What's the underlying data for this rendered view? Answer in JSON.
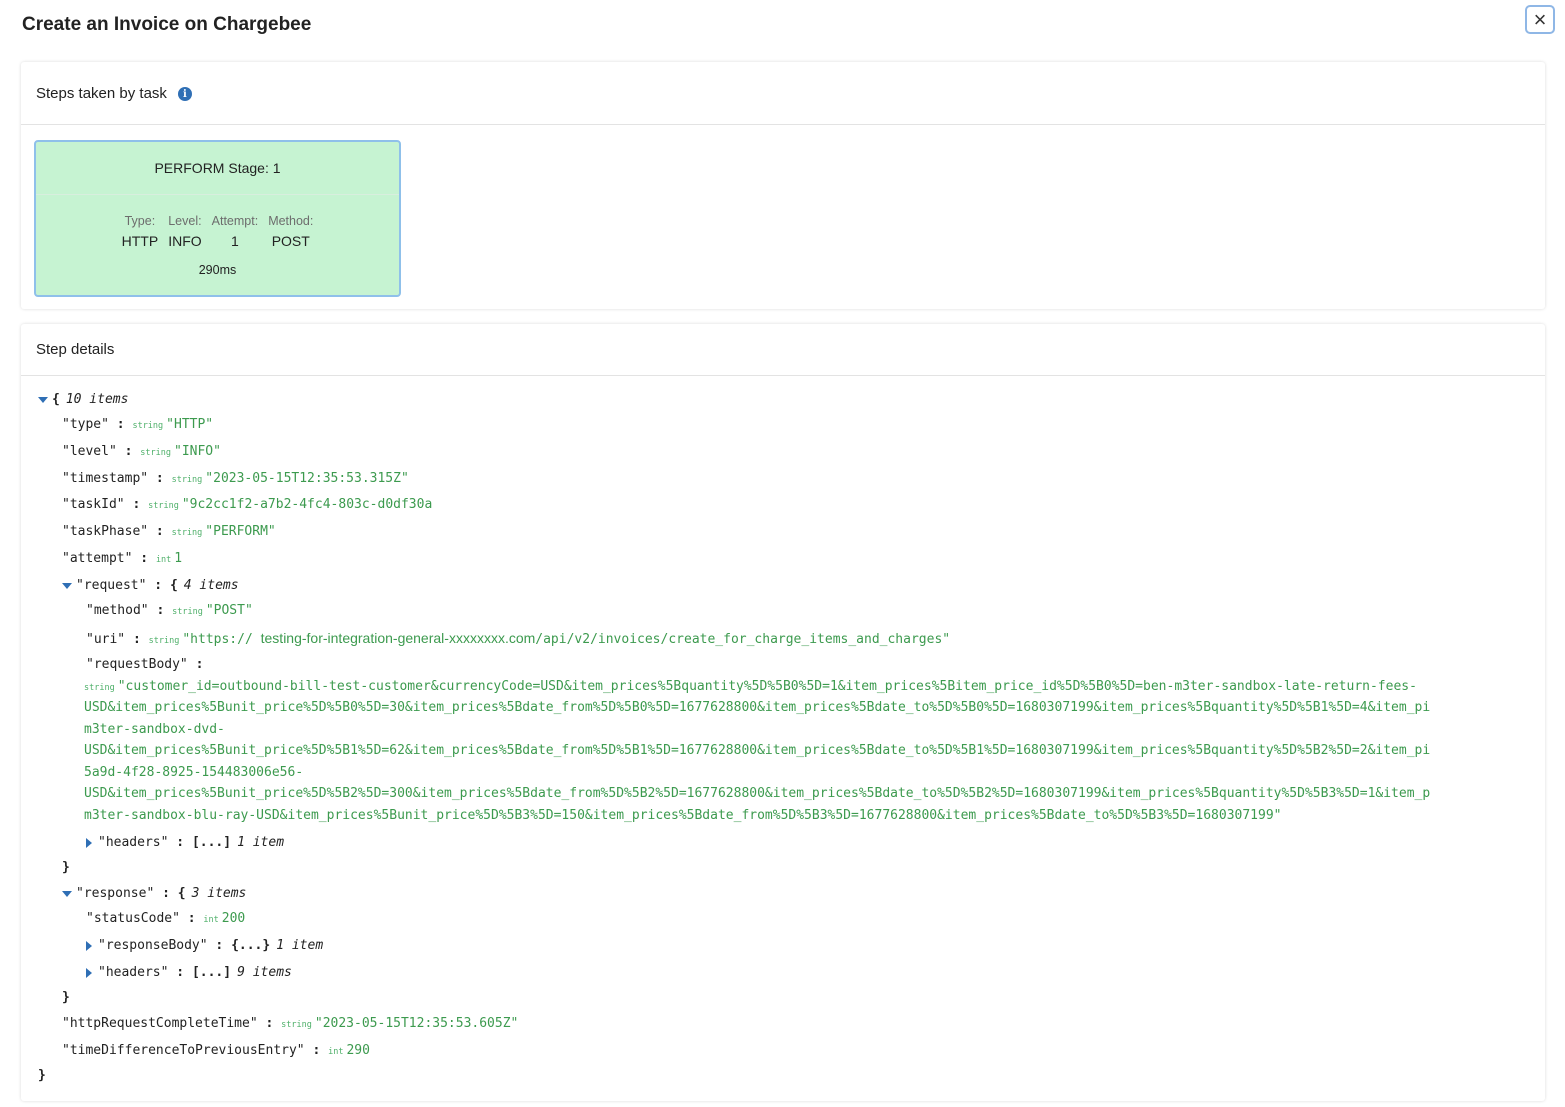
{
  "modal": {
    "title": "Create an Invoice on Chargebee",
    "close_label": "×"
  },
  "steps_panel": {
    "title": "Steps taken by task",
    "info_icon": "i",
    "stage": {
      "title": "PERFORM Stage: 1",
      "type_label": "Type:",
      "type_value": "HTTP",
      "level_label": "Level:",
      "level_value": "INFO",
      "attempt_label": "Attempt:",
      "attempt_value": "1",
      "method_label": "Method:",
      "method_value": "POST",
      "duration": "290ms"
    }
  },
  "details_panel": {
    "title": "Step details",
    "root_count": "10 items",
    "type_key": "\"type\"",
    "type_val": "\"HTTP\"",
    "level_key": "\"level\"",
    "level_val": "\"INFO\"",
    "timestamp_key": "\"timestamp\"",
    "timestamp_val": "\"2023-05-15T12:35:53.315Z\"",
    "taskId_key": "\"taskId\"",
    "taskId_val": "\"9c2cc1f2-a7b2-4fc4-803c-d0df30a",
    "taskPhase_key": "\"taskPhase\"",
    "taskPhase_val": "\"PERFORM\"",
    "attempt_key": "\"attempt\"",
    "attempt_val": "1",
    "request_key": "\"request\"",
    "request_count": "4 items",
    "method_key": "\"method\"",
    "method_val": "\"POST\"",
    "uri_key": "\"uri\"",
    "uri_prefix": "\"https://",
    "uri_host": "testing-for-integration-general-xxxxxxxx.com",
    "uri_path": "/api/v2/invoices/create_for_charge_items_and_charges\"",
    "requestBody_key": "\"requestBody\"",
    "requestBody_lines": [
      "\"customer_id=outbound-bill-test-customer&currencyCode=USD&item_prices%5Bquantity%5D%5B0%5D=1&item_prices%5Bitem_price_id%5D%5B0%5D=ben-m3ter-sandbox-late-return-fees-",
      "USD&item_prices%5Bunit_price%5D%5B0%5D=30&item_prices%5Bdate_from%5D%5B0%5D=1677628800&item_prices%5Bdate_to%5D%5B0%5D=1680307199&item_prices%5Bquantity%5D%5B1%5D=4&item_pi",
      "m3ter-sandbox-dvd-",
      "USD&item_prices%5Bunit_price%5D%5B1%5D=62&item_prices%5Bdate_from%5D%5B1%5D=1677628800&item_prices%5Bdate_to%5D%5B1%5D=1680307199&item_prices%5Bquantity%5D%5B2%5D=2&item_pi",
      "5a9d-4f28-8925-154483006e56-",
      "USD&item_prices%5Bunit_price%5D%5B2%5D=300&item_prices%5Bdate_from%5D%5B2%5D=1677628800&item_prices%5Bdate_to%5D%5B2%5D=1680307199&item_prices%5Bquantity%5D%5B3%5D=1&item_p",
      "m3ter-sandbox-blu-ray-USD&item_prices%5Bunit_price%5D%5B3%5D=150&item_prices%5Bdate_from%5D%5B3%5D=1677628800&item_prices%5Bdate_to%5D%5B3%5D=1680307199\""
    ],
    "req_headers_key": "\"headers\"",
    "req_headers_count": "1 item",
    "response_key": "\"response\"",
    "response_count": "3 items",
    "statusCode_key": "\"statusCode\"",
    "statusCode_val": "200",
    "responseBody_key": "\"responseBody\"",
    "responseBody_count": "1 item",
    "resp_headers_key": "\"headers\"",
    "resp_headers_count": "9 items",
    "httpComplete_key": "\"httpRequestCompleteTime\"",
    "httpComplete_val": "\"2023-05-15T12:35:53.605Z\"",
    "timeDiff_key": "\"timeDifferenceToPreviousEntry\"",
    "timeDiff_val": "290",
    "type_string": "string",
    "type_int": "int",
    "collapsed_array": "[...]",
    "collapsed_object": "{...}"
  }
}
